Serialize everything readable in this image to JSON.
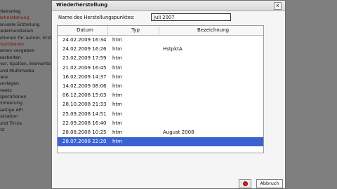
{
  "background": {
    "nav_items": [
      "llleinstieg",
      "erherstellung",
      "anuelle Erstellung",
      "iederherstellen",
      "ptionen für autom. Erste",
      "nsolidieren",
      "amen vergeben",
      "earbeiten",
      "ner, Spalten, Elemente",
      "und Multimedia",
      "lare",
      "vorlagen",
      "heets",
      "operationen",
      "mmierung",
      "seitige API",
      "istration",
      "und Tricks",
      "nz"
    ],
    "active_indices": [
      1,
      5
    ]
  },
  "dialog": {
    "title": "Wiederherstellung",
    "close_label": "x",
    "field_label": "Name des Herstellungspunktes:",
    "field_value": "Juli 2007",
    "columns": [
      "Datum",
      "Typ",
      "Bezeichnung"
    ],
    "rows": [
      {
        "date": "24.02.2009 16:34",
        "type": "htm",
        "desc": ""
      },
      {
        "date": "24.02.2009 16:26",
        "type": "htm",
        "desc": "HstpktA"
      },
      {
        "date": "23.02.2009 17:59",
        "type": "htm",
        "desc": ""
      },
      {
        "date": "21.02.2009 16:45",
        "type": "htm",
        "desc": ""
      },
      {
        "date": "16.02.2009 14:37",
        "type": "htm",
        "desc": ""
      },
      {
        "date": "14.02.2009 08:06",
        "type": "htm",
        "desc": ""
      },
      {
        "date": "06.12.2008 15:03",
        "type": "htm",
        "desc": ""
      },
      {
        "date": "28.10.2008 21:33",
        "type": "htm",
        "desc": ""
      },
      {
        "date": "25.09.2008 14:51",
        "type": "htm",
        "desc": ""
      },
      {
        "date": "22.09.2008 16:40",
        "type": "htm",
        "desc": ""
      },
      {
        "date": "28.08.2008 10:25",
        "type": "htm",
        "desc": "August 2008"
      },
      {
        "date": "28.07.2008 22:20",
        "type": "htm",
        "desc": ""
      }
    ],
    "selected_row": 11,
    "abort_label": "Abbruch"
  }
}
